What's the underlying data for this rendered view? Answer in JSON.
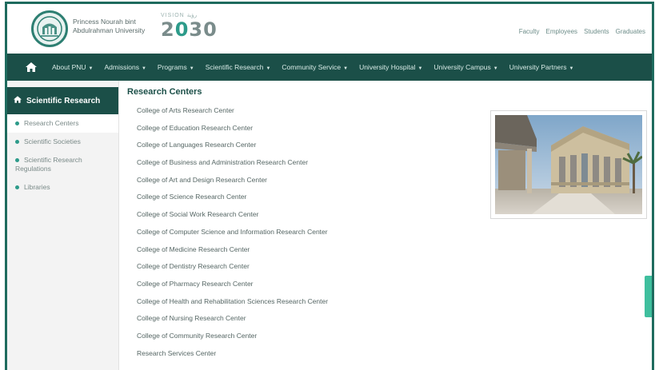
{
  "header": {
    "university_name_line1": "Princess Nourah bint",
    "university_name_line2": "Abdulrahman University",
    "vision_small": "VISION رؤية",
    "vision_year_part1": "2",
    "vision_year_accent": "0",
    "vision_year_part2": "30",
    "top_links": [
      "Faculty",
      "Employees",
      "Students",
      "Graduates"
    ]
  },
  "nav": {
    "items": [
      "About PNU",
      "Admissions",
      "Programs",
      "Scientific Research",
      "Community Service",
      "University Hospital",
      "University Campus",
      "University Partners"
    ]
  },
  "sidebar": {
    "title": "Scientific Research",
    "items": [
      "Research Centers",
      "Scientific Societies",
      "Scientific Research Regulations",
      "Libraries"
    ]
  },
  "main": {
    "title": "Research Centers",
    "centers": [
      "College of Arts Research Center",
      "College of Education Research Center",
      "College of Languages Research Center",
      "College of Business and Administration Research Center",
      "College of Art and Design Research Center",
      "College of Science Research Center",
      "College of Social Work Research Center",
      "College of Computer Science and Information Research Center",
      "College of Medicine Research Center",
      "College of Dentistry Research Center",
      "College of Pharmacy Research Center",
      "College of Health and Rehabilitation Sciences Research Center",
      "College of Nursing Research Center",
      "College of Community Research Center",
      "Research Services Center"
    ]
  },
  "colors": {
    "brand_dark": "#1b4f48",
    "brand_accent": "#2d9b8a",
    "feedback_tab": "#3fbf9e"
  }
}
